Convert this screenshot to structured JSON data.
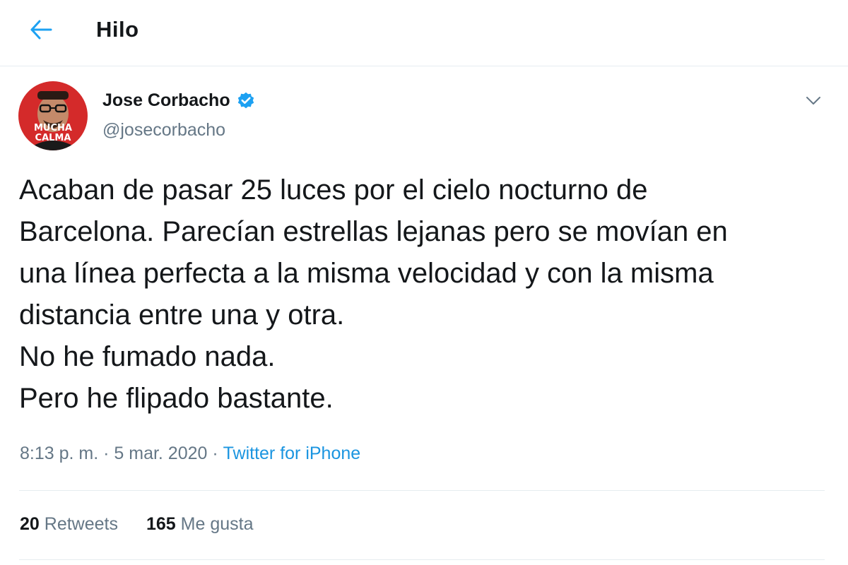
{
  "header": {
    "title": "Hilo",
    "back_icon": "arrow-left-icon",
    "accent_color": "#1da1f2"
  },
  "tweet": {
    "author_name": "Jose Corbacho",
    "author_handle": "@josecorbacho",
    "verified": true,
    "avatar_text": [
      "MUCHA",
      "CALMA"
    ],
    "text": "Acaban de pasar 25 luces por el cielo nocturno de\nBarcelona. Parecían estrellas lejanas pero se movían en\nuna línea perfecta a la misma velocidad  y con la misma\ndistancia entre una y otra.\nNo he fumado nada.\nPero he flipado bastante.",
    "time": "8:13 p. m.",
    "separator": " · ",
    "date": "5 mar. 2020",
    "source": "Twitter for iPhone",
    "source_color": "#1b95e0"
  },
  "stats": {
    "retweets_count": "20",
    "retweets_label": "Retweets",
    "likes_count": "165",
    "likes_label": "Me gusta"
  }
}
